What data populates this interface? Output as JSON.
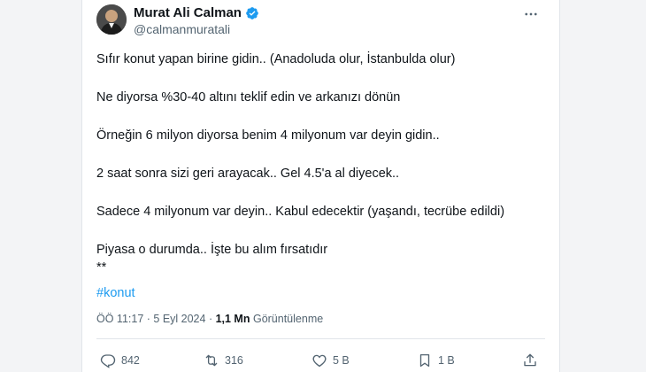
{
  "author": {
    "display_name": "Murat Ali Calman",
    "handle": "@calmanmuratali",
    "verified_icon": "verified-badge-icon",
    "accent": "#1d9bf0"
  },
  "post": {
    "lines": [
      "Sıfır konut yapan birine gidin.. (Anadoluda olur, İstanbulda olur)",
      "Ne diyorsa %30-40 altını teklif edin ve arkanızı dönün",
      "Örneğin 6 milyon diyorsa benim 4 milyonum var deyin gidin..",
      "2 saat sonra sizi geri arayacak.. Gel 4.5'a al diyecek..",
      "Sadece 4 milyonum var deyin.. Kabul edecektir (yaşandı, tecrübe edildi)",
      "Piyasa o durumda.. İşte bu alım fırsatıdır",
      "**"
    ],
    "hashtag": "#konut"
  },
  "meta": {
    "time": "ÖÖ 11:17",
    "separator": " · ",
    "date": "5 Eyl 2024",
    "views_count": "1,1 Mn",
    "views_label": "Görüntülenme"
  },
  "actions": {
    "replies": "842",
    "reposts": "316",
    "likes": "5 B",
    "bookmarks": "1 B"
  }
}
